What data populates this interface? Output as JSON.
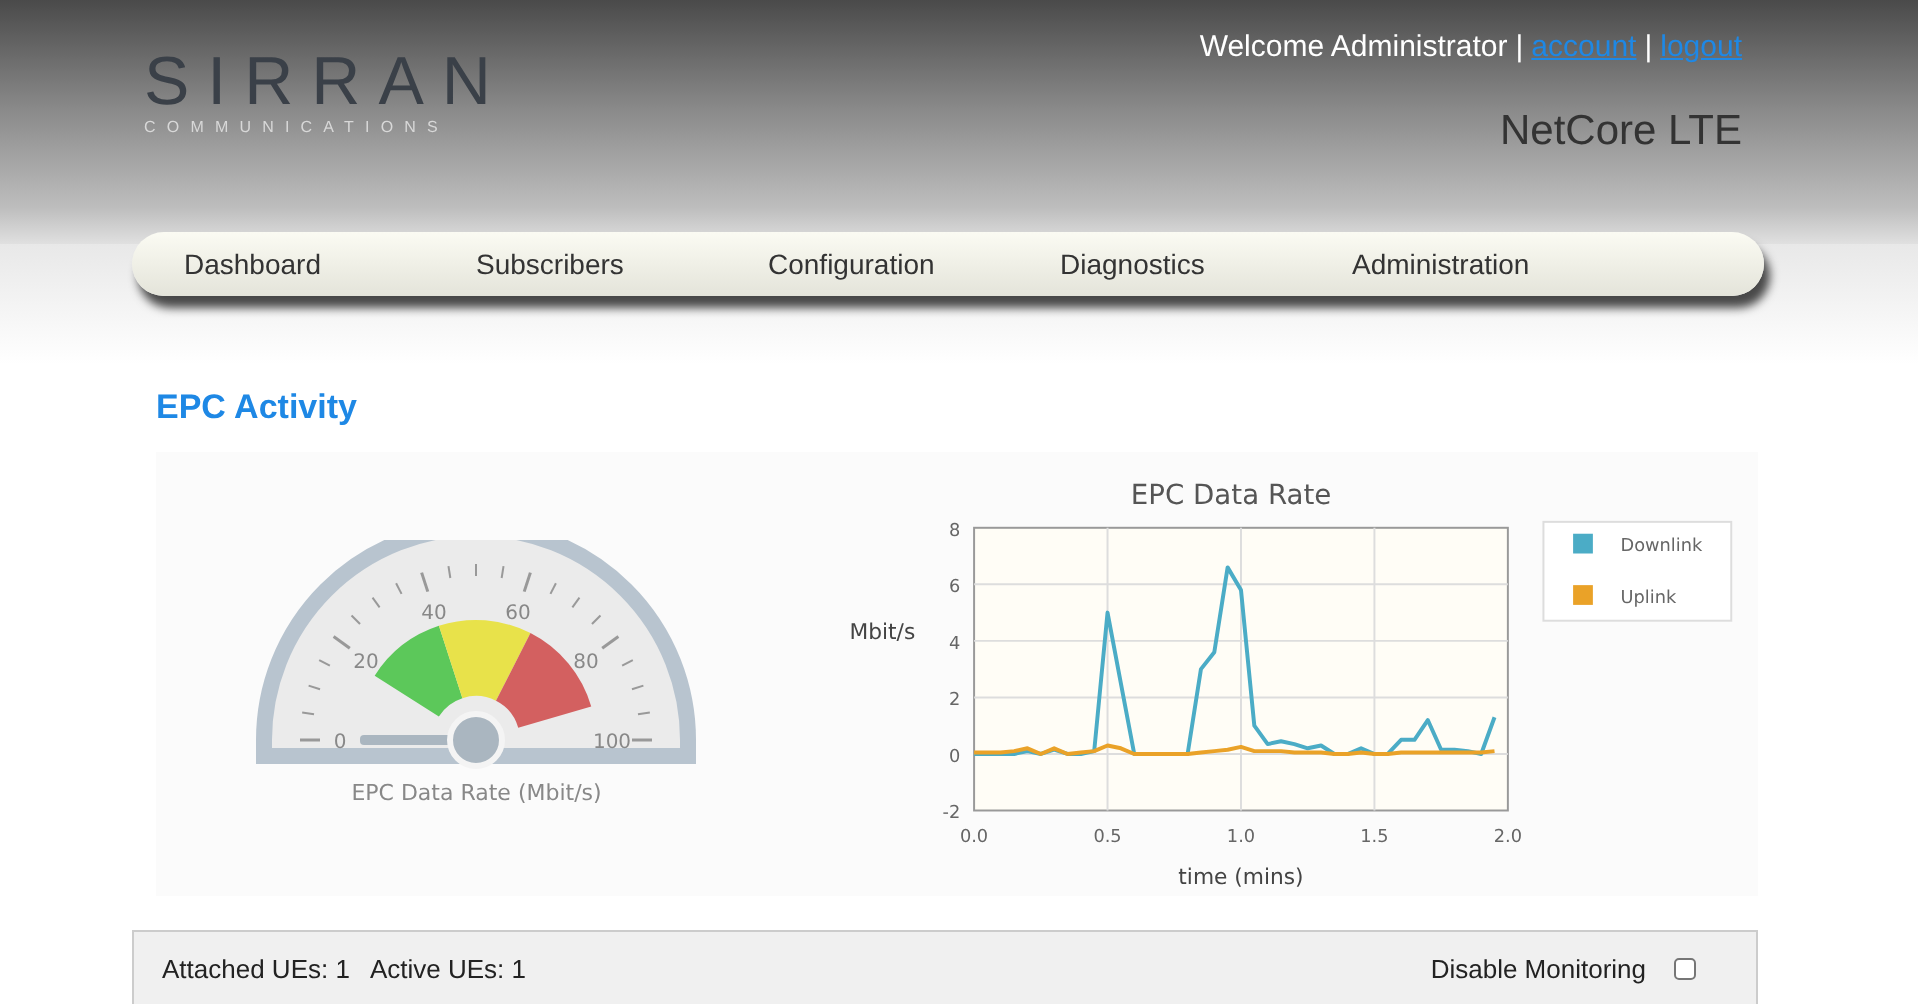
{
  "header": {
    "logo": {
      "name": "SIRRAN",
      "tagline": "COMMUNICATIONS"
    },
    "welcome": "Welcome Administrator",
    "separator": "|",
    "links": [
      "account",
      "logout"
    ],
    "product": "NetCore LTE"
  },
  "nav": [
    {
      "label": "Dashboard",
      "selected": false
    },
    {
      "label": "Subscribers",
      "selected": false
    },
    {
      "label": "Configuration",
      "selected": false
    },
    {
      "label": "Diagnostics",
      "selected": false
    },
    {
      "label": "Administration",
      "selected": false
    }
  ],
  "page_title": "EPC Activity",
  "gauge": {
    "tick_labels": [
      "0",
      "20",
      "40",
      "60",
      "80",
      "100"
    ],
    "caption": "EPC Data Rate (Mbit/s)"
  },
  "chart_data": {
    "type": "line",
    "title": "EPC Data Rate",
    "xlabel": "time (mins)",
    "ylabel": "Mbit/s",
    "x": [
      0,
      0.05,
      0.1,
      0.15,
      0.2,
      0.25,
      0.3,
      0.35,
      0.4,
      0.45,
      0.5,
      0.55,
      0.6,
      0.65,
      0.7,
      0.75,
      0.8,
      0.85,
      0.9,
      0.95,
      1.0,
      1.05,
      1.1,
      1.15,
      1.2,
      1.25,
      1.3,
      1.35,
      1.4,
      1.45,
      1.5,
      1.55,
      1.6,
      1.65,
      1.7,
      1.75,
      1.8,
      1.85,
      1.9,
      1.95
    ],
    "series": [
      {
        "name": "Downlink",
        "color": "#4bacc6",
        "values": [
          0,
          0,
          0,
          0,
          0.1,
          0,
          0.15,
          0,
          0,
          0.1,
          5,
          2.5,
          0,
          0,
          0,
          0,
          0,
          3,
          3.6,
          6.6,
          5.8,
          1,
          0.35,
          0.45,
          0.35,
          0.2,
          0.3,
          0,
          0,
          0.2,
          0,
          0,
          0.5,
          0.5,
          1.2,
          0.15,
          0.15,
          0.1,
          0,
          1.3
        ]
      },
      {
        "name": "Uplink",
        "color": "#eaa228",
        "values": [
          0.05,
          0.05,
          0.05,
          0.1,
          0.2,
          0,
          0.2,
          0,
          0.05,
          0.1,
          0.3,
          0.2,
          0,
          0,
          0,
          0,
          0,
          0.05,
          0.1,
          0.15,
          0.25,
          0.1,
          0.1,
          0.1,
          0.05,
          0.05,
          0.05,
          0,
          0,
          0.05,
          0,
          0,
          0.05,
          0.05,
          0.05,
          0.05,
          0.05,
          0.05,
          0.05,
          0.1
        ]
      }
    ],
    "xlim": [
      0,
      2
    ],
    "ylim": [
      -2,
      8
    ],
    "xticks": [
      {
        "value": 0,
        "label": "0.0"
      },
      {
        "value": 0.5,
        "label": "0.5"
      },
      {
        "value": 1,
        "label": "1.0"
      },
      {
        "value": 1.5,
        "label": "1.5"
      },
      {
        "value": 2,
        "label": "2.0"
      }
    ],
    "yticks": [
      -2,
      0,
      2,
      4,
      6,
      8
    ],
    "grid": true,
    "legend": true
  },
  "status_bar": {
    "stats": [
      "Attached UEs: 1",
      "Active UEs: 1"
    ],
    "monitoring": {
      "label": "Disable Monitoring",
      "checked": false
    }
  }
}
